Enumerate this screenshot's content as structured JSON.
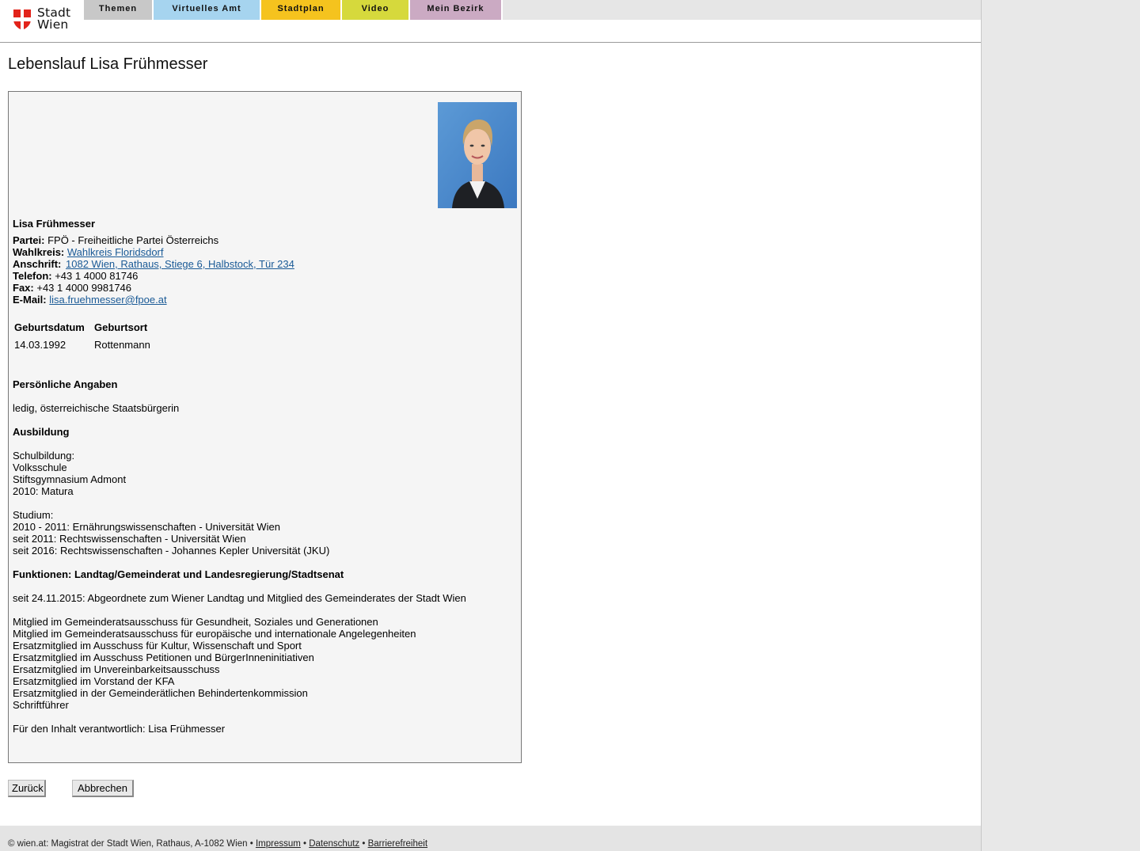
{
  "header": {
    "logo": {
      "line1": "Stadt",
      "line2": "Wien"
    },
    "nav": [
      {
        "label": "Themen",
        "color": "#c8c8c8"
      },
      {
        "label": "Virtuelles Amt",
        "color": "#a6d4ef"
      },
      {
        "label": "Stadtplan",
        "color": "#f5c31e"
      },
      {
        "label": "Video",
        "color": "#d6d93c"
      },
      {
        "label": "Mein Bezirk",
        "color": "#cbaac3"
      }
    ]
  },
  "page_title": "Lebenslauf Lisa Frühmesser",
  "profile": {
    "name": "Lisa Frühmesser",
    "fields": {
      "partei_label": "Partei:",
      "partei_value": "FPÖ - Freiheitliche Partei Österreichs",
      "wahlkreis_label": "Wahlkreis:",
      "wahlkreis_value": "Wahlkreis Floridsdorf",
      "anschrift_label": "Anschrift:",
      "anschrift_value": "1082 Wien, Rathaus, Stiege 6, Halbstock, Tür 234",
      "telefon_label": "Telefon:",
      "telefon_value": "+43 1 4000 81746",
      "fax_label": "Fax:",
      "fax_value": "+43 1 4000 9981746",
      "email_label": "E-Mail:",
      "email_value": "lisa.fruehmesser@fpoe.at"
    },
    "birth_table": {
      "headers": [
        "Geburtsdatum",
        "Geburtsort"
      ],
      "values": [
        "14.03.1992",
        "Rottenmann"
      ]
    },
    "sections": {
      "personal_heading": "Persönliche Angaben",
      "personal_text": "ledig, österreichische Staatsbürgerin",
      "education_heading": "Ausbildung",
      "school_lines": [
        "Schulbildung:",
        "Volksschule",
        "Stiftsgymnasium Admont",
        "2010: Matura"
      ],
      "study_lines": [
        "Studium:",
        "2010 - 2011: Ernährungswissenschaften - Universität Wien",
        "seit 2011: Rechtswissenschaften - Universität Wien",
        "seit 2016: Rechtswissenschaften - Johannes Kepler Universität (JKU)"
      ],
      "functions_heading": "Funktionen: Landtag/Gemeinderat und Landesregierung/Stadtsenat",
      "functions_intro": "seit 24.11.2015: Abgeordnete zum Wiener Landtag und Mitglied des Gemeinderates der Stadt Wien",
      "functions_lines": [
        "Mitglied im Gemeinderatsausschuss für Gesundheit, Soziales und Generationen",
        "Mitglied im Gemeinderatsausschuss für europäische und internationale Angelegenheiten",
        "Ersatzmitglied im Ausschuss für Kultur, Wissenschaft und Sport",
        "Ersatzmitglied im Ausschuss Petitionen und BürgerInneninitiativen",
        "Ersatzmitglied im Unvereinbarkeitsausschuss",
        "Ersatzmitglied im Vorstand der KFA",
        "Ersatzmitglied in der Gemeinderätlichen Behindertenkommission",
        "Schriftführer"
      ],
      "responsible": "Für den Inhalt verantwortlich: Lisa Frühmesser"
    }
  },
  "buttons": {
    "back": "Zurück",
    "cancel": "Abbrechen"
  },
  "footer": {
    "copyright": "© wien.at: Magistrat der Stadt Wien, Rathaus, A-1082 Wien",
    "separator": " • ",
    "links": [
      "Impressum",
      "Datenschutz",
      "Barrierefreiheit"
    ]
  }
}
